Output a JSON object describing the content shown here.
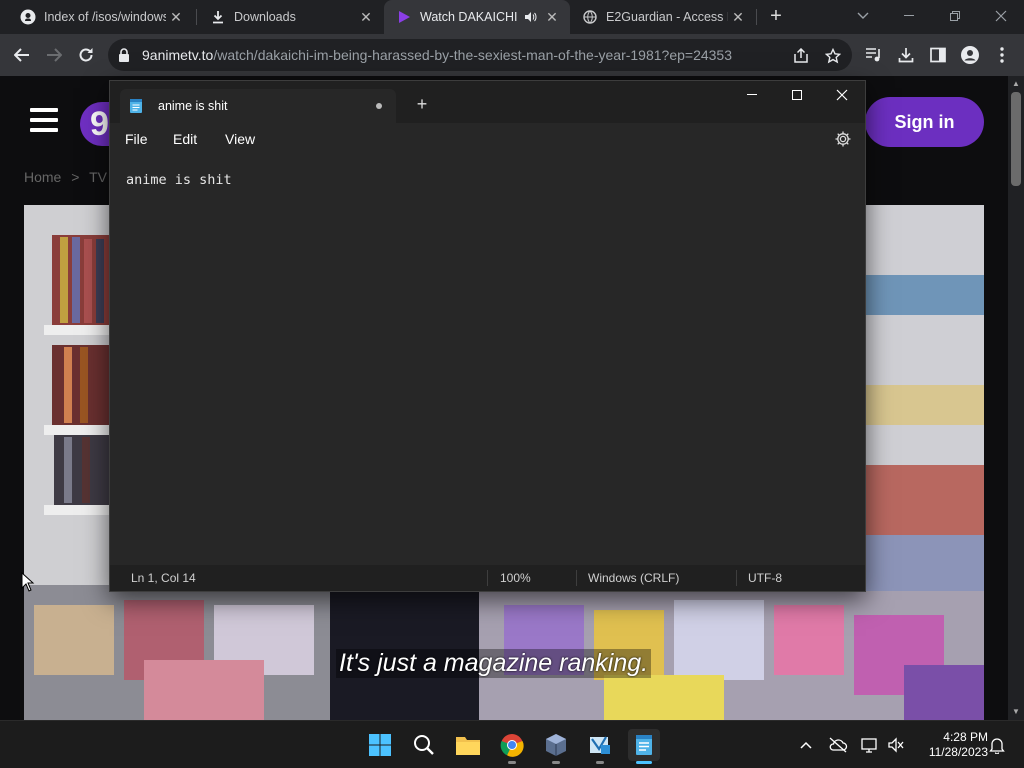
{
  "browser": {
    "tabs": [
      {
        "title": "Index of /isos/windows",
        "icon": "github-icon",
        "active": false
      },
      {
        "title": "Downloads",
        "icon": "download-icon",
        "active": false
      },
      {
        "title": "Watch DAKAICHI",
        "icon": "play-icon",
        "active": true,
        "audio": true
      },
      {
        "title": "E2Guardian - Access D",
        "icon": "globe-icon",
        "active": false
      }
    ],
    "url_host": "9animetv.to",
    "url_path": "/watch/dakaichi-im-being-harassed-by-the-sexiest-man-of-the-year-1981?ep=24353"
  },
  "site": {
    "logo_char": "9",
    "signin_label": "Sign in",
    "breadcrumb_home": "Home",
    "breadcrumb_sep": ">",
    "breadcrumb_next": "TV",
    "subtitle": "It's just a magazine ranking."
  },
  "notepad": {
    "tab_title": "anime is shit",
    "menu": {
      "file": "File",
      "edit": "Edit",
      "view": "View"
    },
    "content": "anime is shit",
    "status": {
      "position": "Ln 1, Col 14",
      "zoom": "100%",
      "line_endings": "Windows (CRLF)",
      "encoding": "UTF-8"
    }
  },
  "taskbar": {
    "time": "4:28 PM",
    "date": "11/28/2023"
  },
  "colors": {
    "accent": "#6c2fc0",
    "taskbar_active": "#4cc2ff"
  }
}
